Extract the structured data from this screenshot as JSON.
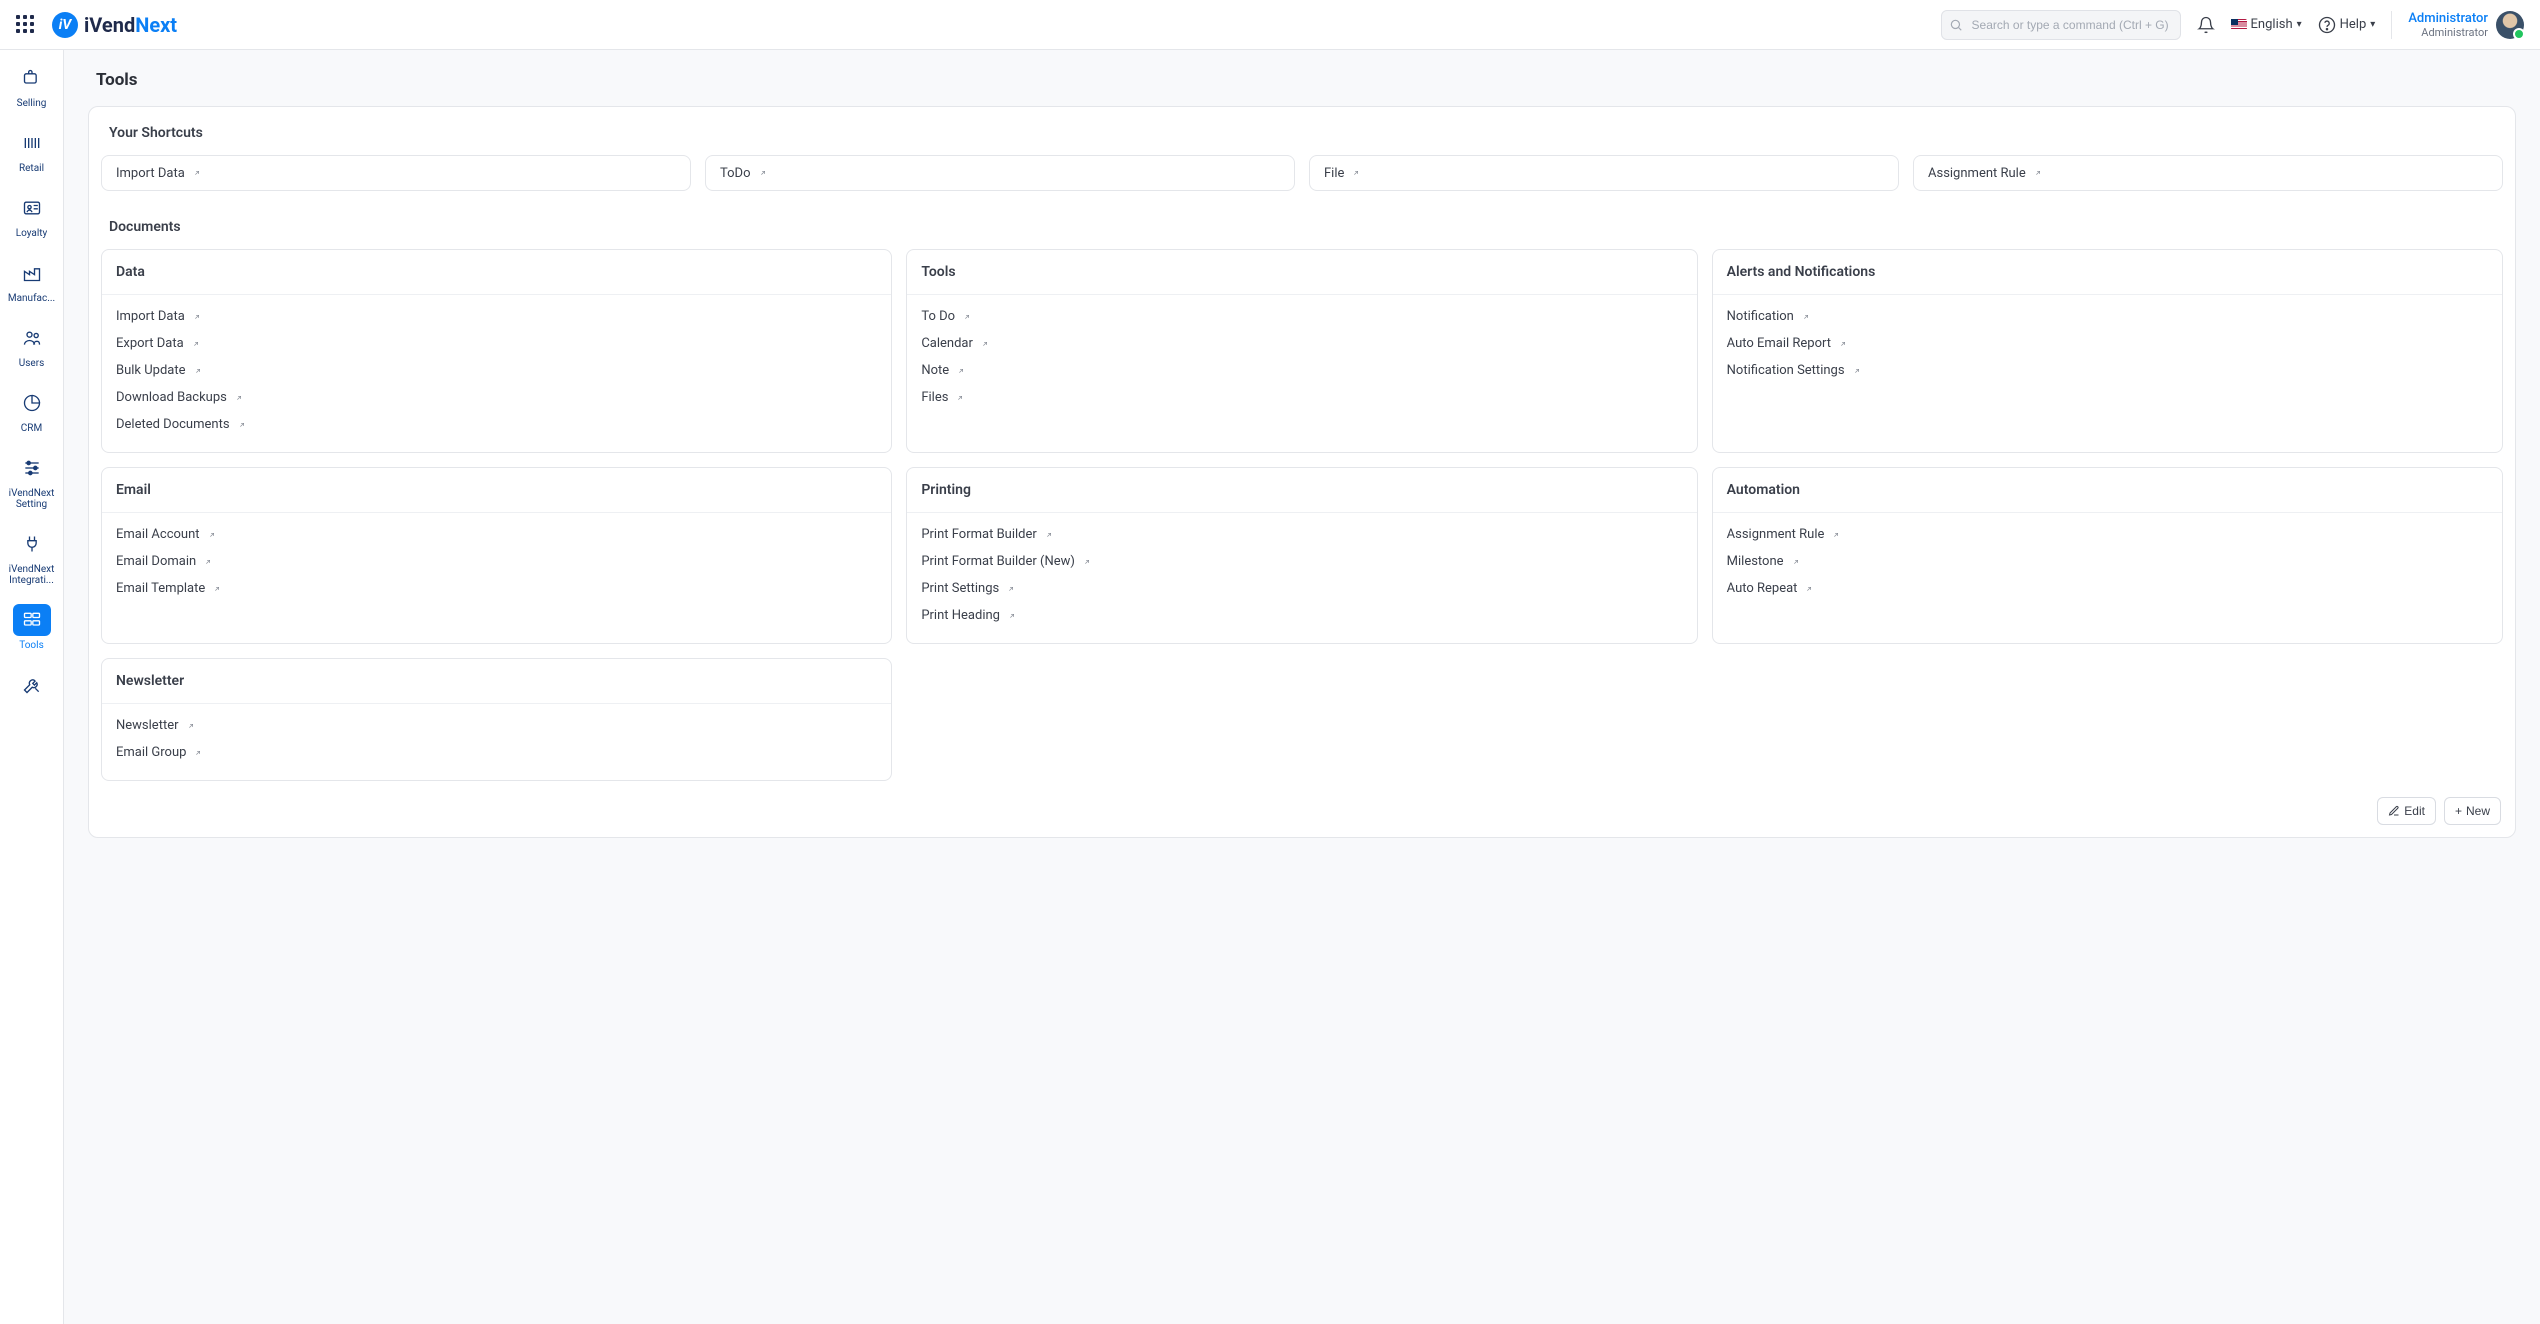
{
  "brand": {
    "text1": "iVend",
    "text2": "Next"
  },
  "search": {
    "placeholder": "Search or type a command (Ctrl + G)"
  },
  "language": "English",
  "help": "Help",
  "user": {
    "name": "Administrator",
    "role": "Administrator"
  },
  "sidebar": [
    {
      "label": "Selling",
      "icon": "tag"
    },
    {
      "label": "Retail",
      "icon": "barcode"
    },
    {
      "label": "Loyalty",
      "icon": "idcard"
    },
    {
      "label": "Manufac...",
      "icon": "factory"
    },
    {
      "label": "Users",
      "icon": "users"
    },
    {
      "label": "CRM",
      "icon": "pie"
    },
    {
      "label": "iVendNext Setting",
      "icon": "sliders"
    },
    {
      "label": "iVendNext Integrati...",
      "icon": "plug"
    },
    {
      "label": "Tools",
      "icon": "tools",
      "active": true
    },
    {
      "label": "",
      "icon": "wrench"
    }
  ],
  "page": {
    "title": "Tools"
  },
  "shortcuts": {
    "title": "Your Shortcuts",
    "items": [
      "Import Data",
      "ToDo",
      "File",
      "Assignment Rule"
    ]
  },
  "documents": {
    "title": "Documents",
    "cards": [
      {
        "title": "Data",
        "items": [
          "Import Data",
          "Export Data",
          "Bulk Update",
          "Download Backups",
          "Deleted Documents"
        ]
      },
      {
        "title": "Tools",
        "items": [
          "To Do",
          "Calendar",
          "Note",
          "Files"
        ]
      },
      {
        "title": "Alerts and Notifications",
        "items": [
          "Notification",
          "Auto Email Report",
          "Notification Settings"
        ]
      },
      {
        "title": "Email",
        "items": [
          "Email Account",
          "Email Domain",
          "Email Template"
        ]
      },
      {
        "title": "Printing",
        "items": [
          "Print Format Builder",
          "Print Format Builder (New)",
          "Print Settings",
          "Print Heading"
        ]
      },
      {
        "title": "Automation",
        "items": [
          "Assignment Rule",
          "Milestone",
          "Auto Repeat"
        ]
      },
      {
        "title": "Newsletter",
        "items": [
          "Newsletter",
          "Email Group"
        ]
      }
    ]
  },
  "actions": {
    "edit": "Edit",
    "new": "New"
  }
}
